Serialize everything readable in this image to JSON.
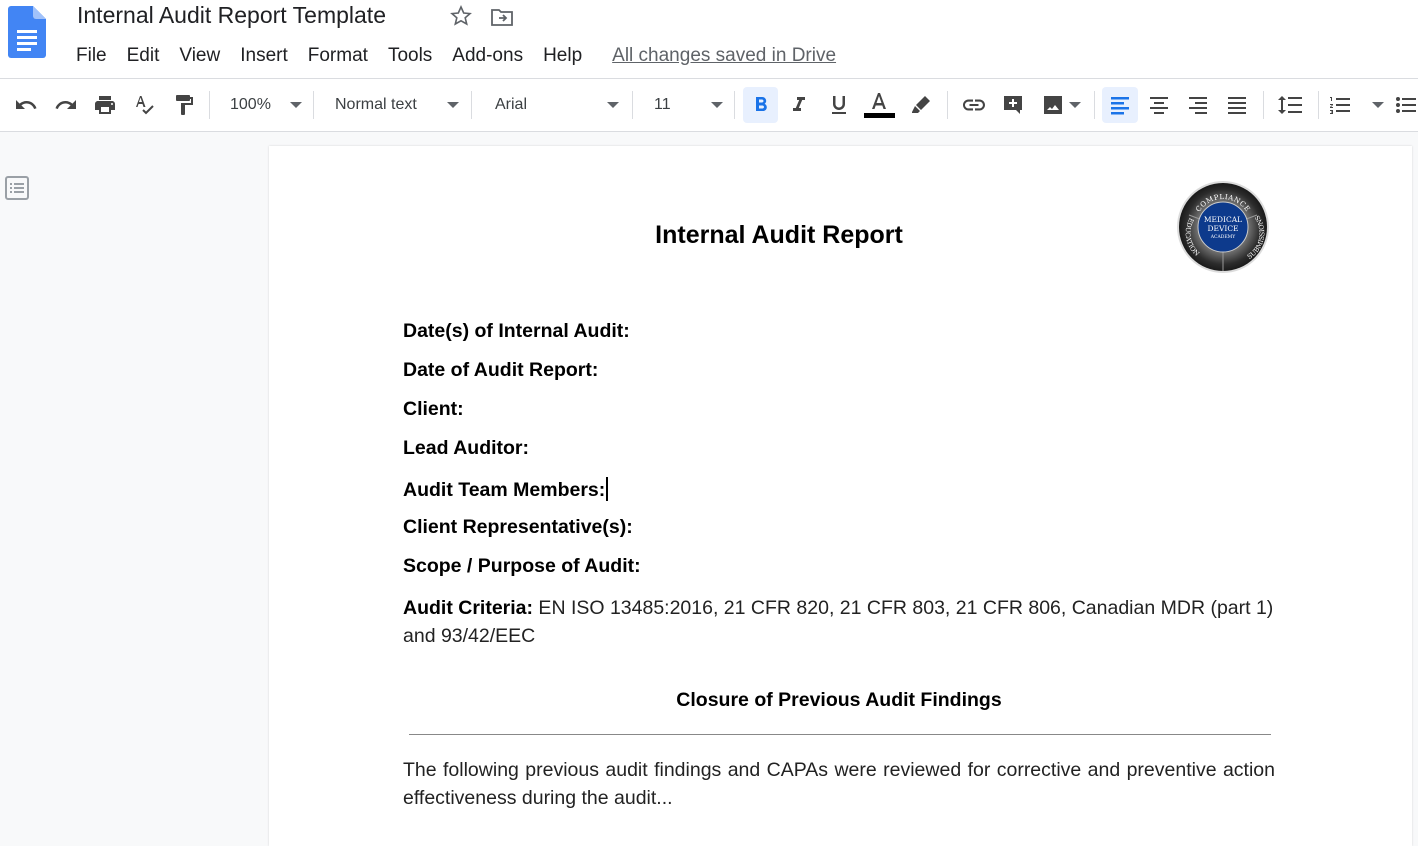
{
  "header": {
    "doc_title": "Internal Audit Report Template",
    "menu": [
      "File",
      "Edit",
      "View",
      "Insert",
      "Format",
      "Tools",
      "Add-ons",
      "Help"
    ],
    "save_status": "All changes saved in Drive"
  },
  "toolbar": {
    "zoom": "100%",
    "style": "Normal text",
    "font": "Arial",
    "font_size": "11",
    "text_color": "#000000",
    "active_color": "#1a73e8",
    "active_bg": "#e8f0fe"
  },
  "document": {
    "title": "Internal Audit Report",
    "logo": {
      "top_text": "COMPLIANCE",
      "left_text": "EDUCATION",
      "right_text": "SUBMISSIONS",
      "center_line1": "MEDICAL",
      "center_line2": "DEVICE",
      "center_line3": "ACADEMY",
      "center_color": "#0d3a8c"
    },
    "fields": [
      {
        "label": "Date(s) of Internal Audit:",
        "value": ""
      },
      {
        "label": "Date of Audit Report:",
        "value": ""
      },
      {
        "label": "Client:",
        "value": ""
      },
      {
        "label": "Lead Auditor:",
        "value": ""
      },
      {
        "label": "Audit Team Members:",
        "value": ""
      },
      {
        "label": "Client Representative(s):",
        "value": ""
      },
      {
        "label": "Scope / Purpose of Audit:",
        "value": ""
      },
      {
        "label": "Audit Criteria:",
        "value": " EN ISO 13485:2016, 21 CFR 820, 21 CFR 803, 21 CFR 806, Canadian MDR (part 1) and 93/42/EEC"
      }
    ],
    "section_heading": "Closure of Previous Audit Findings",
    "section_paragraph": "The following previous audit findings and CAPAs were reviewed for corrective and preventive action effectiveness during the audit..."
  }
}
